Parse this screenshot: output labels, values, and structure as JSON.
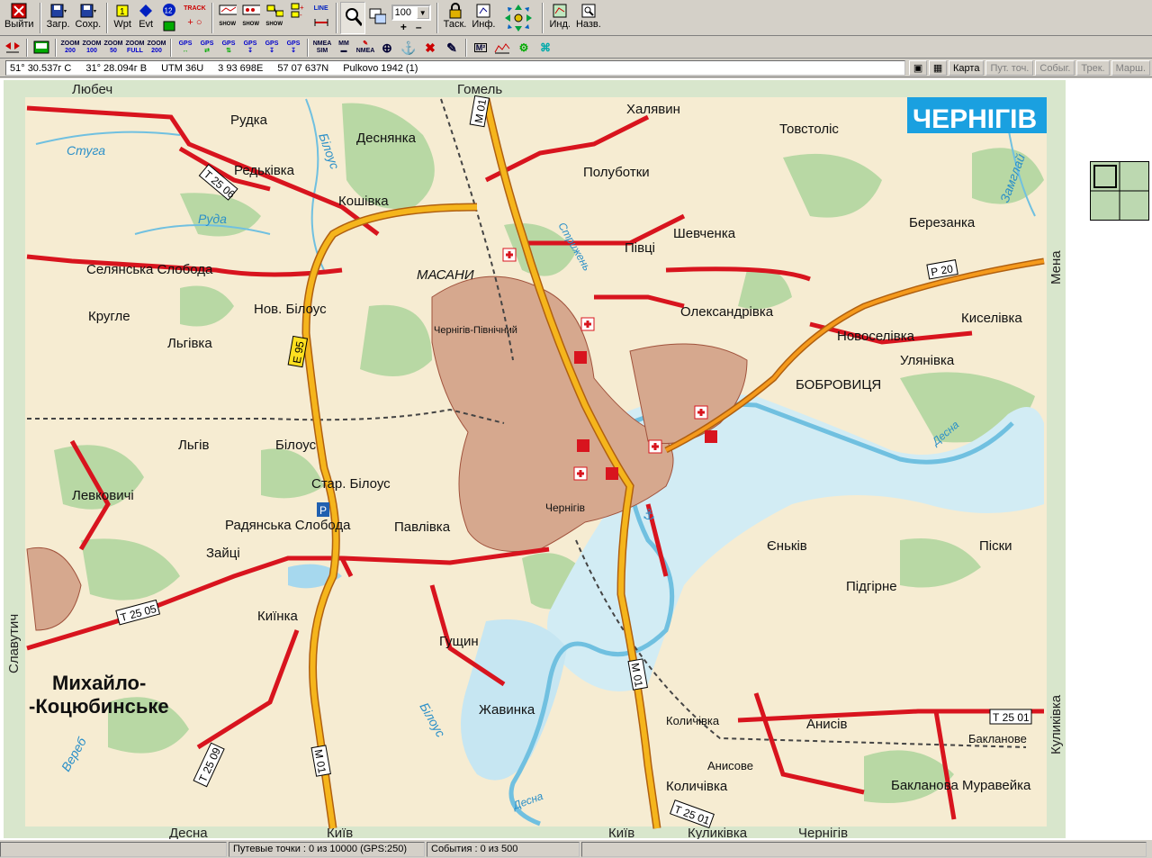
{
  "toolbar": {
    "exit_label": "Выйти",
    "load_label": "Загр.",
    "save_label": "Сохр.",
    "wpt_label": "Wpt",
    "evt_label": "Evt",
    "num_badge": "12",
    "track_label": "TRACK",
    "show_label": "SHOW",
    "line_label": "LINE",
    "zoom_value": "100",
    "task_label": "Таск.",
    "info_label": "Инф.",
    "ind_label": "Инд.",
    "name_label": "Назв."
  },
  "toolbar2": {
    "zoom_buttons": [
      {
        "top": "ZOOM",
        "bottom": "200"
      },
      {
        "top": "ZOOM",
        "bottom": "100"
      },
      {
        "top": "ZOOM",
        "bottom": "50"
      },
      {
        "top": "ZOOM",
        "bottom": "FULL"
      },
      {
        "top": "ZOOM",
        "bottom": "200"
      }
    ],
    "gps_buttons": [
      "GPS",
      "GPS",
      "GPS",
      "GPS",
      "GPS",
      "GPS"
    ],
    "nmea_sim": "NMEA SIM",
    "mm": "MM",
    "nmea": "NMEA",
    "m2": "M²"
  },
  "coords": {
    "lat": "51° 30.537г С",
    "lon": "31° 28.094г В",
    "utm": "UTM  36U",
    "easting": "3 93 698E",
    "northing": "57 07 637N",
    "datum": "Pulkovo 1942 (1)"
  },
  "right_buttons": {
    "map": "Карта",
    "waypoints": "Пут. точ.",
    "events": "Собыг.",
    "tracks": "Трек.",
    "routes": "Марш."
  },
  "map": {
    "title": "ЧЕРНІГІВ",
    "edge_labels": {
      "top_left": "Любеч",
      "top_center": "Гомель",
      "bottom_kyiv": "Київ",
      "bottom_desna": "Десна",
      "bottom_kyiv2": "Київ",
      "bottom_kulykivka": "Куликівка",
      "bottom_chernihiv": "Чернігів",
      "left": "Славутич",
      "right_top": "Мена",
      "right_bottom": "Куликівка"
    },
    "places": [
      {
        "name": "Рудка"
      },
      {
        "name": "Халявин"
      },
      {
        "name": "Товстоліс"
      },
      {
        "name": "Деснянка"
      },
      {
        "name": "Редьківка"
      },
      {
        "name": "Полуботки"
      },
      {
        "name": "Кошівка"
      },
      {
        "name": "Шевченка"
      },
      {
        "name": "Березанка"
      },
      {
        "name": "Селянська Слобода"
      },
      {
        "name": "Півці"
      },
      {
        "name": "МАСАНИ"
      },
      {
        "name": "Кругле"
      },
      {
        "name": "Нов. Білоус"
      },
      {
        "name": "Олександрівка"
      },
      {
        "name": "Киселівка"
      },
      {
        "name": "Льгівка"
      },
      {
        "name": "Новоселівка"
      },
      {
        "name": "Чернігів-Північний"
      },
      {
        "name": "Улянівка"
      },
      {
        "name": "БОБРОВИЦЯ"
      },
      {
        "name": "Льгів"
      },
      {
        "name": "Білоус"
      },
      {
        "name": "Левковичі"
      },
      {
        "name": "Стар. Білоус"
      },
      {
        "name": "Радянська Слобода"
      },
      {
        "name": "Чернігів"
      },
      {
        "name": "Павлівка"
      },
      {
        "name": "Зайці"
      },
      {
        "name": "Єньків"
      },
      {
        "name": "Піски"
      },
      {
        "name": "Підгірне"
      },
      {
        "name": "Киїнка"
      },
      {
        "name": "Гущин"
      },
      {
        "name": "Жавинка"
      },
      {
        "name": "Количівка"
      },
      {
        "name": "Анисів"
      },
      {
        "name": "Бакланове"
      },
      {
        "name": "Анисове"
      },
      {
        "name": "Бакланова Муравейка"
      },
      {
        "name": "Количівка"
      },
      {
        "name": "Михайло-"
      },
      {
        "name": "-Коцюбинське"
      }
    ],
    "rivers": [
      "Стуга",
      "Руда",
      "Білоус",
      "Стрижень",
      "Десна",
      "Замглай",
      "Білоус",
      "Вереб",
      "Десна"
    ],
    "road_labels": [
      "Т 25 06",
      "М 01",
      "Е 95",
      "Р 20",
      "Т 25 05",
      "М 01",
      "Т 25 09",
      "М 01",
      "Т 25 01",
      "Т 25 01"
    ]
  },
  "status": {
    "waypoints": "Путевые точки : 0 из 10000  (GPS:250)",
    "events": "События : 0 из 500"
  }
}
